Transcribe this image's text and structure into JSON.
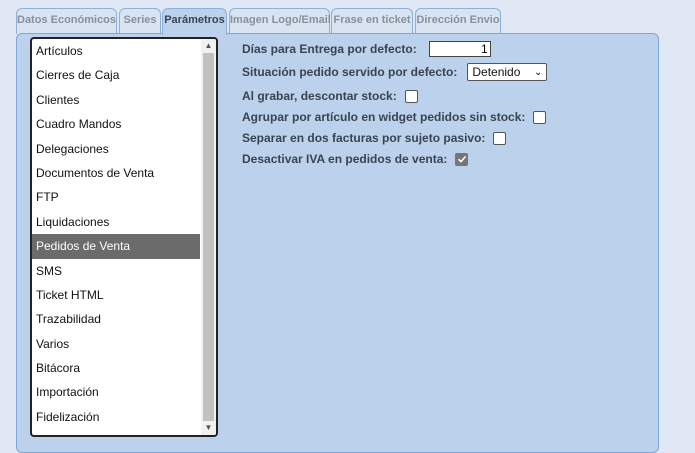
{
  "tabs": [
    {
      "label": "Datos Económicos",
      "active": false
    },
    {
      "label": "Series",
      "active": false
    },
    {
      "label": "Parámetros",
      "active": true
    },
    {
      "label": "Imagen Logo/Email",
      "active": false
    },
    {
      "label": "Frase en ticket",
      "active": false
    },
    {
      "label": "Dirección Envio",
      "active": false
    }
  ],
  "sidebar": {
    "items": [
      "Artículos",
      "Cierres de Caja",
      "Clientes",
      "Cuadro Mandos",
      "Delegaciones",
      "Documentos de Venta",
      "FTP",
      "Liquidaciones",
      "Pedidos de Venta",
      "SMS",
      "Ticket HTML",
      "Trazabilidad",
      "Varios",
      "Bitácora",
      "Importación",
      "Fidelización"
    ],
    "selected_index": 8,
    "scroll_up_icon": "triangle-up-icon",
    "scroll_down_icon": "triangle-down-icon"
  },
  "form": {
    "delivery_days": {
      "label": "Días para Entrega por defecto:",
      "value": "1"
    },
    "order_status": {
      "label": "Situación pedido servido por defecto:",
      "value": "Detenido"
    },
    "discount_stock": {
      "label": "Al grabar, descontar stock:",
      "checked": false
    },
    "group_by_article": {
      "label": "Agrupar por artículo en widget pedidos sin stock:",
      "checked": false
    },
    "split_invoices": {
      "label": "Separar en dos facturas por sujeto pasivo:",
      "checked": false
    },
    "disable_vat": {
      "label": "Desactivar IVA en pedidos de venta:",
      "checked": true
    }
  },
  "colors": {
    "panel": "#bcd2ec",
    "selected_item": "#6b6b6b",
    "checkbox_checked": "#767676"
  }
}
